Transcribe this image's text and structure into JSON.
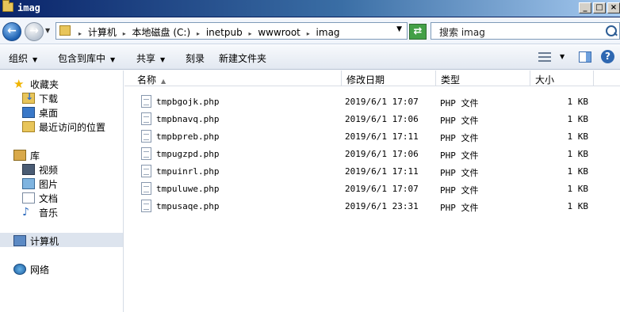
{
  "window": {
    "title": "imag",
    "controls": [
      "_",
      "□",
      "×"
    ]
  },
  "address": {
    "crumbs": [
      "计算机",
      "本地磁盘 (C:)",
      "inetpub",
      "wwwroot",
      "imag"
    ],
    "search_placeholder": "搜索 imag"
  },
  "toolbar": {
    "organize": "组织",
    "include_in_library": "包含到库中",
    "share": "共享",
    "burn": "刻录",
    "new_folder": "新建文件夹"
  },
  "nav": {
    "favorites": "收藏夹",
    "downloads": "下载",
    "desktop": "桌面",
    "recent": "最近访问的位置",
    "libraries": "库",
    "videos": "视频",
    "pictures": "图片",
    "documents": "文档",
    "music": "音乐",
    "computer": "计算机",
    "network": "网络"
  },
  "columns": {
    "name": "名称",
    "date": "修改日期",
    "type": "类型",
    "size": "大小"
  },
  "files": [
    {
      "name": "tmpbgojk.php",
      "date": "2019/6/1 17:07",
      "type": "PHP 文件",
      "size": "1 KB"
    },
    {
      "name": "tmpbnavq.php",
      "date": "2019/6/1 17:06",
      "type": "PHP 文件",
      "size": "1 KB"
    },
    {
      "name": "tmpbpreb.php",
      "date": "2019/6/1 17:11",
      "type": "PHP 文件",
      "size": "1 KB"
    },
    {
      "name": "tmpugzpd.php",
      "date": "2019/6/1 17:06",
      "type": "PHP 文件",
      "size": "1 KB"
    },
    {
      "name": "tmpuinrl.php",
      "date": "2019/6/1 17:11",
      "type": "PHP 文件",
      "size": "1 KB"
    },
    {
      "name": "tmpuluwe.php",
      "date": "2019/6/1 17:07",
      "type": "PHP 文件",
      "size": "1 KB"
    },
    {
      "name": "tmpusaqe.php",
      "date": "2019/6/1 23:31",
      "type": "PHP 文件",
      "size": "1 KB"
    }
  ]
}
